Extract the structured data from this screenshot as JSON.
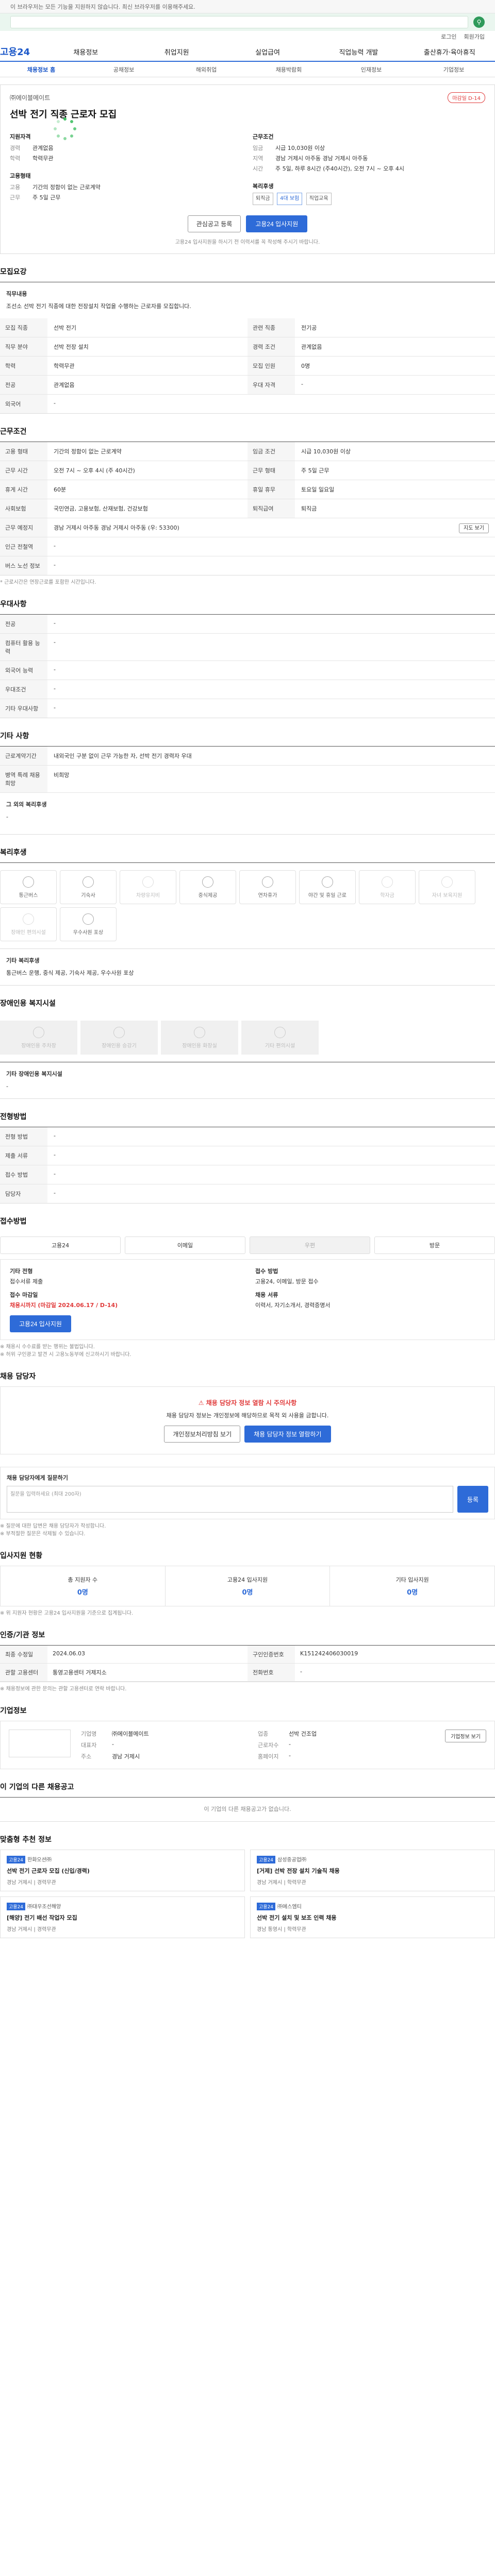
{
  "topbar": {
    "notice": "이 브라우저는 모든 기능을 지원하지 않습니다. 최신 브라우저를 이용해주세요."
  },
  "util": {
    "links": [
      "로그인",
      "회원가입"
    ]
  },
  "gnb": {
    "logo": "고용24",
    "items": [
      "채용정보",
      "취업지원",
      "실업급여",
      "직업능력 개발",
      "출산휴가·육아휴직"
    ]
  },
  "subnav": {
    "items": [
      "채용정보 홈",
      "공채정보",
      "해외취업",
      "채용박람회",
      "인재정보",
      "기업정보"
    ],
    "active_index": 0
  },
  "job": {
    "company": "㈜에이블메이트",
    "badge": "마감일 D-14",
    "title": "선박 전기 직종 근로자 모집",
    "qualification_title": "지원자격",
    "qualification": [
      {
        "k": "경력",
        "v": "관계없음"
      },
      {
        "k": "학력",
        "v": "학력무관"
      }
    ],
    "work_title": "근무조건",
    "work": [
      {
        "k": "임금",
        "v": "시급 10,030원 이상"
      },
      {
        "k": "지역",
        "v": "경남 거제시 아주동 경남 거제시 아주동"
      },
      {
        "k": "시간",
        "v": "주 5일, 하루 8시간 (주40시간), 오전 7시 ~ 오후 4시"
      }
    ],
    "employ_title": "고용형태",
    "employ": [
      {
        "k": "고용",
        "v": "기간의 정함이 없는 근로계약"
      },
      {
        "k": "근무",
        "v": "주 5일 근무"
      }
    ],
    "welfare_title": "복리후생",
    "welfare_chips": [
      "퇴직금",
      "4대 보험",
      "직업교육"
    ],
    "btn_interest": "관심공고 등록",
    "btn_apply": "고용24 입사지원",
    "note": "고용24 입사지원을 하시기 전 이력서를 꼭 작성해 주시기 바랍니다."
  },
  "recruit": {
    "title": "모집요강",
    "desc_title": "직무내용",
    "desc": "조선소 선박 전기 직종에 대한 전장설치 작업을 수행하는 근로자를 모집합니다.",
    "rows": [
      {
        "th": "모집 직종",
        "td": "선박 전기",
        "th2": "관련 직종",
        "td2": "전기공"
      },
      {
        "th": "직무 분야",
        "td": "선박 전장 설치",
        "th2": "경력 조건",
        "td2": "관계없음"
      },
      {
        "th": "학력",
        "td": "학력무관",
        "th2": "모집 인원",
        "td2": "0명"
      },
      {
        "th": "전공",
        "td": "관계없음",
        "th2": "우대 자격",
        "td2": "-"
      },
      {
        "th": "외국어",
        "td": "-",
        "th2": "",
        "td2": ""
      }
    ]
  },
  "conditions": {
    "title": "근무조건",
    "rows": [
      {
        "th": "고용 형태",
        "td": "기간의 정함이 없는 근로계약",
        "th2": "임금 조건",
        "td2": "시급 10,030원 이상"
      },
      {
        "th": "근무 시간",
        "td": "오전 7시 ~ 오후 4시 (주 40시간)",
        "th2": "근무 형태",
        "td2": "주 5일 근무"
      },
      {
        "th": "휴게 시간",
        "td": "60분",
        "th2": "휴일 휴무",
        "td2": "토요일 일요일"
      },
      {
        "th": "사회보험",
        "td": "국민연금, 고용보험, 산재보험, 건강보험",
        "th2": "퇴직급여",
        "td2": "퇴직금"
      },
      {
        "th": "근무 예정지",
        "td": "경남 거제시 아주동 경남 거제시 아주동 (우: 53300)",
        "th2": "",
        "td2": ""
      },
      {
        "th": "인근 전철역",
        "td": "-",
        "th2": "",
        "td2": ""
      },
      {
        "th": "버스 노선 정보",
        "td": "-",
        "th2": "",
        "td2": ""
      }
    ],
    "map_btn": "지도 보기",
    "note": "* 근로시간은 연장근로를 포함한 시간입니다."
  },
  "preference": {
    "title": "우대사항",
    "rows": [
      {
        "th": "전공",
        "td": "-"
      },
      {
        "th": "컴퓨터 활용 능력",
        "td": "-"
      },
      {
        "th": "외국어 능력",
        "td": "-"
      },
      {
        "th": "우대조건",
        "td": "-"
      },
      {
        "th": "기타 우대사항",
        "td": "-"
      }
    ]
  },
  "other": {
    "title": "기타 사항",
    "rows": [
      {
        "th": "근로계약기간",
        "td": "내외국인 구분 없이 근무 가능한 자, 선박 전기 경력자 우대"
      },
      {
        "th": "병역 특례 채용 희망",
        "td": "비희망"
      }
    ],
    "extra_title": "그 외의 복리후생",
    "extra": "-"
  },
  "welfare": {
    "title": "복리후생",
    "cards": [
      {
        "label": "통근버스",
        "on": true
      },
      {
        "label": "기숙사",
        "on": true
      },
      {
        "label": "차량유지비",
        "on": false
      },
      {
        "label": "중식제공",
        "on": true
      },
      {
        "label": "연차휴가",
        "on": true
      },
      {
        "label": "야간 및 휴일 근로",
        "on": true
      },
      {
        "label": "학자금",
        "on": false
      },
      {
        "label": "자녀 보육지원",
        "on": false
      },
      {
        "label": "장애인 편의시설",
        "on": false
      },
      {
        "label": "우수사원 포상",
        "on": true
      }
    ],
    "extra_title": "기타 복리후생",
    "extra": "통근버스 운행, 중식 제공, 기숙사 제공, 우수사원 포상"
  },
  "disability": {
    "title": "장애인용 복지시설",
    "cards": [
      "장애인용 주차장",
      "장애인용 승강기",
      "장애인용 화장실",
      "기타 편의시설"
    ],
    "extra_title": "기타 장애인용 복지시설",
    "extra": "-"
  },
  "screening": {
    "title": "전형방법",
    "rows": [
      {
        "th": "전형 방법",
        "td": "-"
      },
      {
        "th": "제출 서류",
        "td": "-"
      },
      {
        "th": "접수 방법",
        "td": "-"
      },
      {
        "th": "담당자",
        "td": "-"
      }
    ]
  },
  "apply": {
    "title": "접수방법",
    "methods": [
      {
        "label": "고용24",
        "on": true
      },
      {
        "label": "이메일",
        "on": true
      },
      {
        "label": "우편",
        "on": false
      },
      {
        "label": "방문",
        "on": true
      }
    ],
    "period_title": "기타 전형",
    "period": "접수서류 제출",
    "deadline_title": "접수 마감일",
    "deadline": "채용시까지 (마감일 2024.06.17 / D-14)",
    "docs_title": "접수 방법",
    "docs": "고용24, 이메일, 방문 접수",
    "manager_title": "채용 서류",
    "manager": "이력서, 자기소개서, 경력증명서",
    "btn_apply": "고용24 입사지원",
    "notes": [
      "※ 채용시 수수료를 받는 행위는 불법입니다.",
      "※ 허위 구인광고 발견 시 고용노동부에 신고하시기 바랍니다."
    ]
  },
  "contact": {
    "title": "채용 담당자",
    "warn": "채용 담당자 정보 열람 시 주의사항",
    "desc": "채용 담당자 정보는 개인정보에 해당하므로 목적 외 사용을 금합니다.",
    "btn_view": "개인정보처리방침 보기",
    "btn_agree": "채용 담당자 정보 열람하기"
  },
  "qna": {
    "title": "채용 담당자에게 질문하기",
    "placeholder": "질문을 입력하세요 (최대 200자)",
    "btn": "등록",
    "notes": [
      "※ 질문에 대한 답변은 채용 담당자가 작성합니다.",
      "※ 부적절한 질문은 삭제될 수 있습니다."
    ]
  },
  "status": {
    "title": "입사지원 현황",
    "cells": [
      {
        "label": "총 지원자 수",
        "num": "0명"
      },
      {
        "label": "고용24 입사지원",
        "num": "0명"
      },
      {
        "label": "기타 입사지원",
        "num": "0명"
      }
    ],
    "note": "※ 위 지원자 현황은 고용24 입사지원을 기준으로 집계됩니다."
  },
  "info": {
    "title": "인증/기관 정보",
    "rows": [
      {
        "th": "최종 수정일",
        "td": "2024.06.03"
      },
      {
        "th": "구인인증번호",
        "td": "K151242406030019"
      },
      {
        "th": "관할 고용센터",
        "td": "통영고용센터 거제지소"
      },
      {
        "th": "전화번호",
        "td": "-"
      }
    ],
    "note": "※ 채용정보에 관한 문의는 관할 고용센터로 연락 바랍니다."
  },
  "company": {
    "title": "기업정보",
    "rows": [
      {
        "k": "기업명",
        "v": "㈜에이블메이트"
      },
      {
        "k": "업종",
        "v": "선박 건조업"
      },
      {
        "k": "대표자",
        "v": "-"
      },
      {
        "k": "근로자수",
        "v": "-"
      },
      {
        "k": "주소",
        "v": "경남 거제시"
      },
      {
        "k": "홈페이지",
        "v": "-"
      }
    ],
    "btn": "기업정보 보기"
  },
  "similar": {
    "title": "이 기업의 다른 채용공고",
    "empty": "이 기업의 다른 채용공고가 없습니다."
  },
  "recommend": {
    "title": "맞춤형 추천 정보",
    "cards": [
      {
        "tag": "고용24",
        "cmp": "한화오션㈜",
        "ttl": "선박 전기 근로자 모집 (신입/경력)",
        "meta": "경남 거제시 | 경력무관"
      },
      {
        "tag": "고용24",
        "cmp": "삼성중공업㈜",
        "ttl": "[거제] 선박 전장 설치 기술직 채용",
        "meta": "경남 거제시 | 학력무관"
      },
      {
        "tag": "고용24",
        "cmp": "㈜대우조선해양",
        "ttl": "[해양] 전기 배선 작업자 모집",
        "meta": "경남 거제시 | 경력무관"
      },
      {
        "tag": "고용24",
        "cmp": "㈜에스엠티",
        "ttl": "선박 전기 설치 및 보조 인력 채용",
        "meta": "경남 통영시 | 학력무관"
      }
    ]
  },
  "colors": {
    "primary": "#2e6bd8",
    "danger": "#e03a3a",
    "brand_green": "#2e9a5a"
  }
}
